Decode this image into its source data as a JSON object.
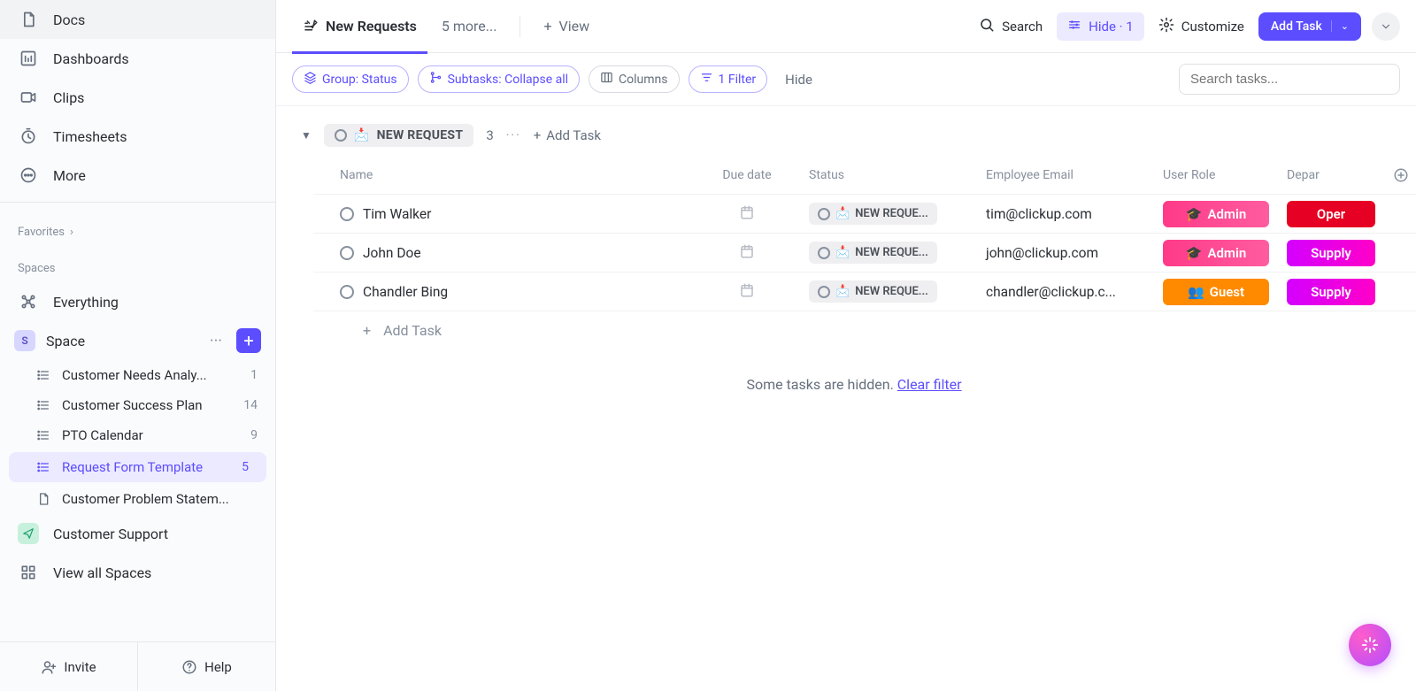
{
  "sidebar": {
    "nav": [
      {
        "label": "Docs"
      },
      {
        "label": "Dashboards"
      },
      {
        "label": "Clips"
      },
      {
        "label": "Timesheets"
      },
      {
        "label": "More"
      }
    ],
    "favorites_label": "Favorites",
    "spaces_label": "Spaces",
    "everything_label": "Everything",
    "space": {
      "initial": "S",
      "name": "Space"
    },
    "lists": [
      {
        "label": "Customer Needs Analy...",
        "count": "1",
        "active": false,
        "icon": "list"
      },
      {
        "label": "Customer Success Plan",
        "count": "14",
        "active": false,
        "icon": "list"
      },
      {
        "label": "PTO Calendar",
        "count": "9",
        "active": false,
        "icon": "list"
      },
      {
        "label": "Request Form Template",
        "count": "5",
        "active": true,
        "icon": "list"
      },
      {
        "label": "Customer Problem Statem...",
        "count": "",
        "active": false,
        "icon": "doc"
      }
    ],
    "customer_support_label": "Customer Support",
    "view_all_spaces_label": "View all Spaces",
    "footer": {
      "invite": "Invite",
      "help": "Help"
    }
  },
  "toolbar": {
    "active_tab_label": "New Requests",
    "more_tabs_label": "5 more...",
    "view_label": "View",
    "search_label": "Search",
    "hide_label": "Hide · 1",
    "customize_label": "Customize",
    "add_task_label": "Add Task"
  },
  "filters": {
    "group_label": "Group: Status",
    "subtasks_label": "Subtasks: Collapse all",
    "columns_label": "Columns",
    "filter_label": "1 Filter",
    "hide_label": "Hide",
    "search_placeholder": "Search tasks..."
  },
  "group": {
    "status_text": "NEW REQUEST",
    "status_emoji": "📩",
    "count": "3",
    "add_task_label": "Add Task"
  },
  "columns": {
    "name": "Name",
    "due": "Due date",
    "status": "Status",
    "email": "Employee Email",
    "role": "User Role",
    "dept": "Depar"
  },
  "rows": [
    {
      "name": "Tim Walker",
      "status_emoji": "📩",
      "status": "NEW REQUE...",
      "email": "tim@clickup.com",
      "role_emoji": "🎓",
      "role": "Admin",
      "role_class": "admin",
      "dept": "Oper",
      "dept_class": "dept-oper"
    },
    {
      "name": "John Doe",
      "status_emoji": "📩",
      "status": "NEW REQUE...",
      "email": "john@clickup.com",
      "role_emoji": "🎓",
      "role": "Admin",
      "role_class": "admin",
      "dept": "Supply",
      "dept_class": "dept-supply"
    },
    {
      "name": "Chandler Bing",
      "status_emoji": "📩",
      "status": "NEW REQUE...",
      "email": "chandler@clickup.c...",
      "role_emoji": "👥",
      "role": "Guest",
      "role_class": "guest",
      "dept": "Supply",
      "dept_class": "dept-supply"
    }
  ],
  "add_task_row_label": "Add Task",
  "hidden_note": {
    "text": "Some tasks are hidden. ",
    "link": "Clear filter"
  }
}
